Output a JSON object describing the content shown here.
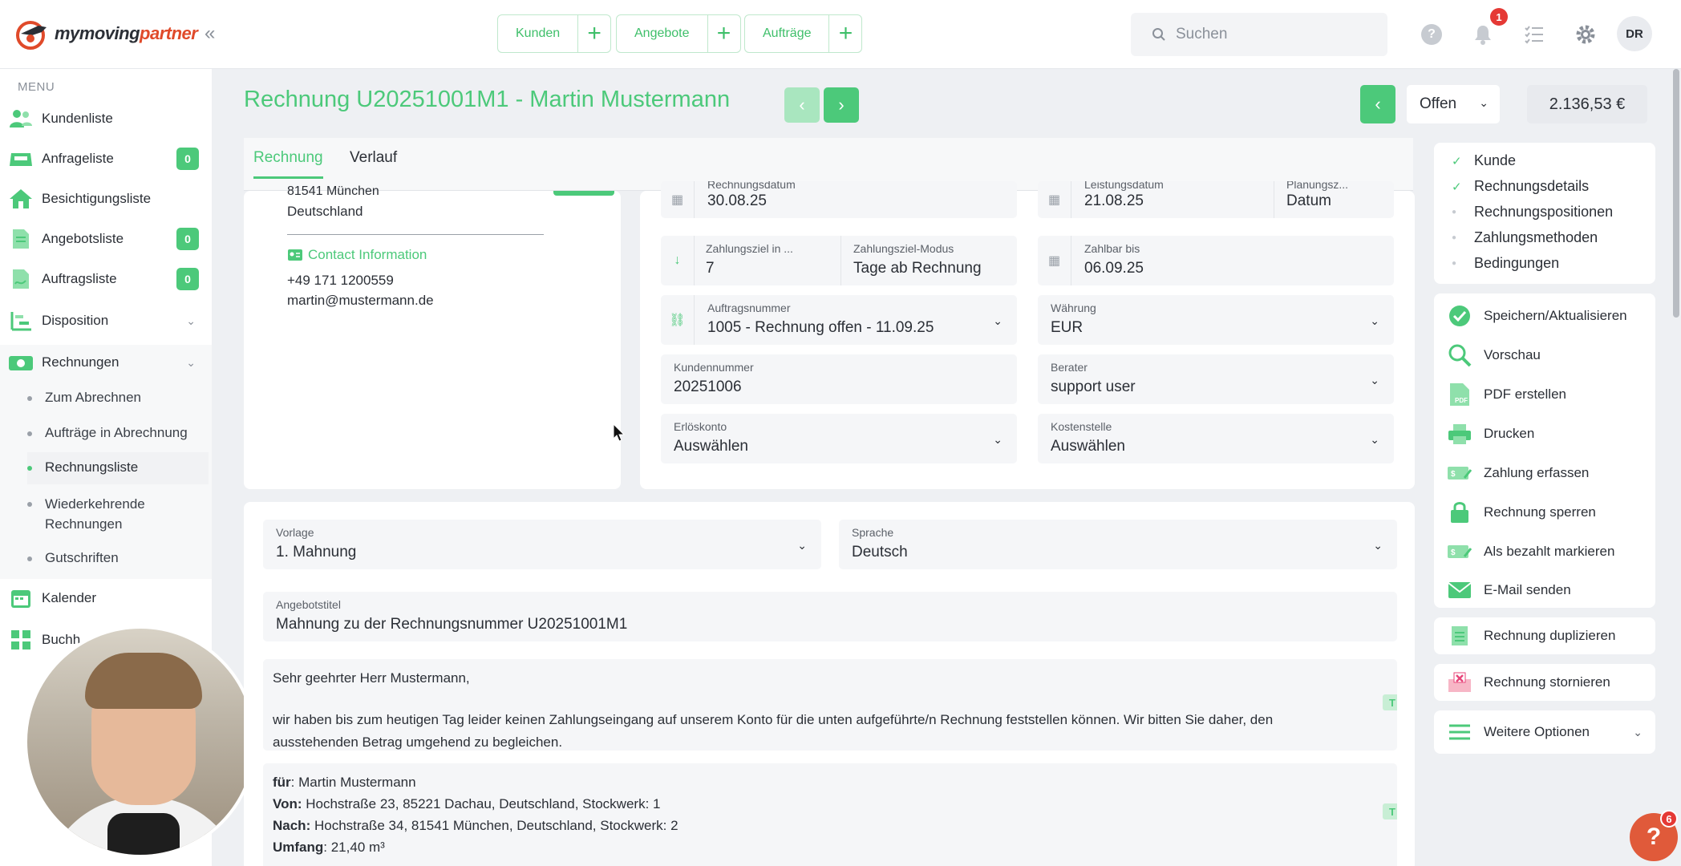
{
  "app": {
    "logo_prefix": "my",
    "logo_main": "moving",
    "logo_suffix": "partner"
  },
  "topnav": {
    "groups": [
      {
        "label": "Kunden"
      },
      {
        "label": "Angebote"
      },
      {
        "label": "Aufträge"
      }
    ],
    "plus": "+",
    "search_placeholder": "Suchen",
    "notification_count": "1",
    "user_initials": "DR",
    "icons": [
      "search-icon",
      "help-icon",
      "bell-icon",
      "checklist-icon",
      "gear-icon"
    ]
  },
  "sidebar": {
    "menu_title": "MENU",
    "items": [
      {
        "label": "Kundenliste"
      },
      {
        "label": "Anfrageliste",
        "badge": "0"
      },
      {
        "label": "Besichtigungsliste"
      },
      {
        "label": "Angebotsliste",
        "badge": "0"
      },
      {
        "label": "Auftragsliste",
        "badge": "0"
      },
      {
        "label": "Disposition"
      },
      {
        "label": "Rechnungen"
      },
      {
        "label": "Kalender"
      },
      {
        "label": "Buchh"
      }
    ],
    "subitems": [
      {
        "label": "Zum Abrechnen"
      },
      {
        "label": "Aufträge in Abrechnung"
      },
      {
        "label": "Rechnungsliste"
      },
      {
        "label": "Wiederkehrende Rechnungen"
      },
      {
        "label": "Gutschriften"
      }
    ]
  },
  "header": {
    "title": "Rechnung U20251001M1 - Martin Mustermann",
    "status": "Offen",
    "amount": "2.136,53 €",
    "prev": "‹",
    "next": "›"
  },
  "tabs": [
    {
      "label": "Rechnung"
    },
    {
      "label": "Verlauf"
    }
  ],
  "customer": {
    "city_line": "81541 München",
    "country": "Deutschland",
    "contact_heading": "Contact Information",
    "phone": "+49 171 1200559",
    "email": "martin@mustermann.de"
  },
  "details": {
    "rechnungsdatum_label": "Rechnungsdatum",
    "rechnungsdatum": "30.08.25",
    "leistungsdatum_label": "Leistungsdatum",
    "leistungsdatum": "21.08.25",
    "planung_label": "Planungsz...",
    "planung": "Datum",
    "zahlungsziel_label": "Zahlungsziel in ...",
    "zahlungsziel": "7",
    "modus_label": "Zahlungsziel-Modus",
    "modus": "Tage ab Rechnung",
    "zahlbar_label": "Zahlbar bis",
    "zahlbar": "06.09.25",
    "auftrag_label": "Auftragsnummer",
    "auftrag": "1005 - Rechnung offen - 11.09.25",
    "waehrung_label": "Währung",
    "waehrung": "EUR",
    "kundennummer_label": "Kundennummer",
    "kundennummer": "20251006",
    "berater_label": "Berater",
    "berater": "support user",
    "erloes_label": "Erlöskonto",
    "erloes": "Auswählen",
    "kosten_label": "Kostenstelle",
    "kosten": "Auswählen"
  },
  "letter": {
    "vorlage_label": "Vorlage",
    "vorlage": "1. Mahnung",
    "sprache_label": "Sprache",
    "sprache": "Deutsch",
    "titel_label": "Angebotstitel",
    "titel": "Mahnung zu der Rechnungsnummer U20251001M1",
    "greeting": "Sehr geehrter Herr Mustermann,",
    "body_line1": "wir haben bis zum heutigen Tag leider keinen Zahlungseingang auf unserem Konto für die unten aufgeführte/n Rechnung feststellen können. Wir bitten Sie daher, den",
    "body_line2": "ausstehenden Betrag umgehend zu begleichen.",
    "fuer_label": "für",
    "fuer": ": Martin Mustermann",
    "von_label": "Von:",
    "von": " Hochstraße 23, 85221 Dachau, Deutschland, Stockwerk: 1",
    "nach_label": "Nach:",
    "nach": " Hochstraße 34, 81541 München, Deutschland, Stockwerk: 2",
    "umfang_label": "Umfang",
    "umfang": ": 21,40 m³",
    "t_button": "T"
  },
  "rightpanel": {
    "steps": [
      {
        "label": "Kunde",
        "done": true
      },
      {
        "label": "Rechnungsdetails",
        "done": true
      },
      {
        "label": "Rechnungspositionen",
        "done": false
      },
      {
        "label": "Zahlungsmethoden",
        "done": false
      },
      {
        "label": "Bedingungen",
        "done": false
      }
    ],
    "actions": [
      {
        "label": "Speichern/Aktualisieren"
      },
      {
        "label": "Vorschau"
      },
      {
        "label": "PDF erstellen"
      },
      {
        "label": "Drucken"
      },
      {
        "label": "Zahlung erfassen"
      },
      {
        "label": "Rechnung sperren"
      },
      {
        "label": "Als bezahlt markieren"
      },
      {
        "label": "E-Mail senden"
      }
    ],
    "duplicate": "Rechnung duplizieren",
    "cancel": "Rechnung stornieren",
    "more": "Weitere Optionen"
  },
  "fab": {
    "label": "?",
    "badge": "6"
  },
  "colors": {
    "accent": "#4cc97a",
    "brand_red": "#e04a2a",
    "danger": "#e53935"
  }
}
